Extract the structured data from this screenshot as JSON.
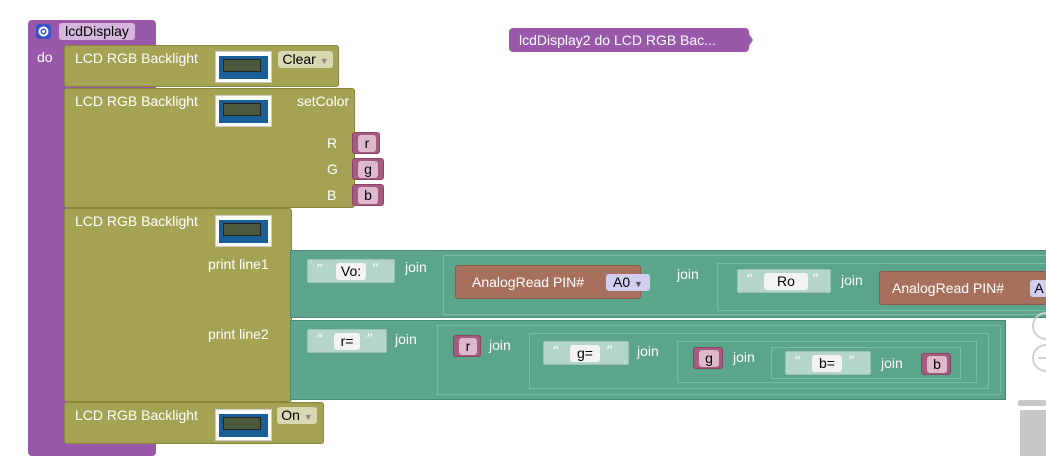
{
  "procedure": {
    "name": "lcdDisplay",
    "do_label": "do"
  },
  "call_block": {
    "label": "lcdDisplay2  do LCD RGB Bac..."
  },
  "block1": {
    "title": "LCD RGB Backlight",
    "dropdown": "Clear"
  },
  "block2": {
    "title": "LCD RGB Backlight",
    "action": "setColor",
    "r_label": "R",
    "g_label": "G",
    "b_label": "B",
    "r_var": "r",
    "g_var": "g",
    "b_var": "b"
  },
  "block3": {
    "title": "LCD RGB Backlight",
    "line1_label": "print line1",
    "line2_label": "print line2",
    "line1": {
      "str1": "Vo:",
      "join1": "join",
      "analog1": "AnalogRead PIN#",
      "pin1": "A0",
      "join2": "join",
      "str2": "Ro",
      "join3": "join",
      "analog2": "AnalogRead PIN#",
      "pin2": "A"
    },
    "line2": {
      "str1": "r=",
      "join1": "join",
      "var1": "r",
      "join2": "join",
      "str2": "g=",
      "join3": "join",
      "var2": "g",
      "join4": "join",
      "str3": "b=",
      "join5": "join",
      "var3": "b"
    }
  },
  "block4": {
    "title": "LCD RGB Backlight",
    "dropdown": "On"
  },
  "colors": {
    "procedure": "#9a58aa",
    "lcd_block": "#a4a354",
    "text_join": "#5ba58b",
    "analog": "#a7705d",
    "variable": "#a55b80"
  },
  "icons": [
    "gear-icon",
    "lcd-image-icon",
    "dropdown-arrow-icon",
    "zoom-in-icon",
    "zoom-out-icon",
    "trash-icon"
  ]
}
